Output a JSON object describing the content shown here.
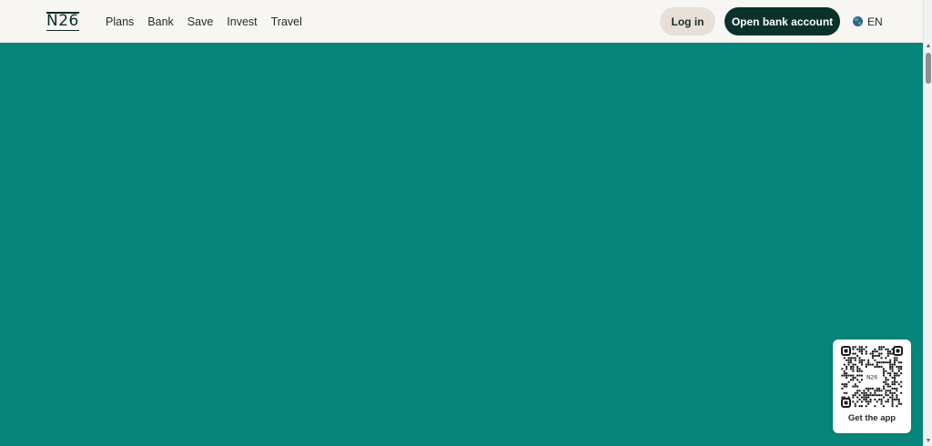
{
  "header": {
    "logo_text": "N26",
    "nav": [
      {
        "label": "Plans"
      },
      {
        "label": "Bank"
      },
      {
        "label": "Save"
      },
      {
        "label": "Invest"
      },
      {
        "label": "Travel"
      }
    ],
    "login_label": "Log in",
    "open_account_label": "Open bank account",
    "language_label": "EN",
    "language_icon": "globe-icon"
  },
  "qr_card": {
    "label": "Get the app",
    "qr_logo_text": "N26"
  },
  "colors": {
    "hero_background": "#08857a",
    "header_background": "#f8f6f3",
    "primary_button": "#0b312b",
    "secondary_button": "#e6e0d9"
  }
}
